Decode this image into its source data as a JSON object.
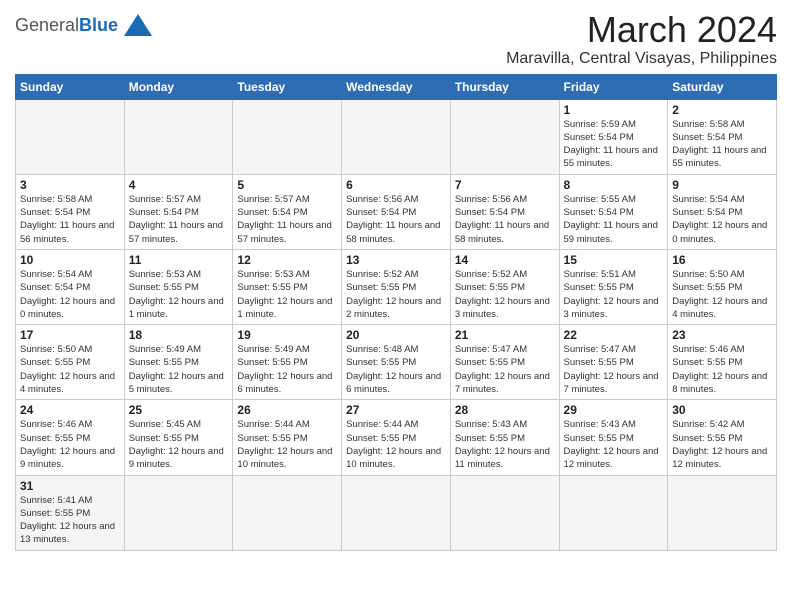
{
  "header": {
    "logo_general": "General",
    "logo_blue": "Blue",
    "month_title": "March 2024",
    "location": "Maravilla, Central Visayas, Philippines"
  },
  "days_of_week": [
    "Sunday",
    "Monday",
    "Tuesday",
    "Wednesday",
    "Thursday",
    "Friday",
    "Saturday"
  ],
  "weeks": [
    [
      {
        "day": "",
        "empty": true
      },
      {
        "day": "",
        "empty": true
      },
      {
        "day": "",
        "empty": true
      },
      {
        "day": "",
        "empty": true
      },
      {
        "day": "",
        "empty": true
      },
      {
        "day": "1",
        "sunrise": "5:59 AM",
        "sunset": "5:54 PM",
        "daylight": "11 hours and 55 minutes."
      },
      {
        "day": "2",
        "sunrise": "5:58 AM",
        "sunset": "5:54 PM",
        "daylight": "11 hours and 55 minutes."
      }
    ],
    [
      {
        "day": "3",
        "sunrise": "5:58 AM",
        "sunset": "5:54 PM",
        "daylight": "11 hours and 56 minutes."
      },
      {
        "day": "4",
        "sunrise": "5:57 AM",
        "sunset": "5:54 PM",
        "daylight": "11 hours and 57 minutes."
      },
      {
        "day": "5",
        "sunrise": "5:57 AM",
        "sunset": "5:54 PM",
        "daylight": "11 hours and 57 minutes."
      },
      {
        "day": "6",
        "sunrise": "5:56 AM",
        "sunset": "5:54 PM",
        "daylight": "11 hours and 58 minutes."
      },
      {
        "day": "7",
        "sunrise": "5:56 AM",
        "sunset": "5:54 PM",
        "daylight": "11 hours and 58 minutes."
      },
      {
        "day": "8",
        "sunrise": "5:55 AM",
        "sunset": "5:54 PM",
        "daylight": "11 hours and 59 minutes."
      },
      {
        "day": "9",
        "sunrise": "5:54 AM",
        "sunset": "5:54 PM",
        "daylight": "12 hours and 0 minutes."
      }
    ],
    [
      {
        "day": "10",
        "sunrise": "5:54 AM",
        "sunset": "5:54 PM",
        "daylight": "12 hours and 0 minutes."
      },
      {
        "day": "11",
        "sunrise": "5:53 AM",
        "sunset": "5:55 PM",
        "daylight": "12 hours and 1 minute."
      },
      {
        "day": "12",
        "sunrise": "5:53 AM",
        "sunset": "5:55 PM",
        "daylight": "12 hours and 1 minute."
      },
      {
        "day": "13",
        "sunrise": "5:52 AM",
        "sunset": "5:55 PM",
        "daylight": "12 hours and 2 minutes."
      },
      {
        "day": "14",
        "sunrise": "5:52 AM",
        "sunset": "5:55 PM",
        "daylight": "12 hours and 3 minutes."
      },
      {
        "day": "15",
        "sunrise": "5:51 AM",
        "sunset": "5:55 PM",
        "daylight": "12 hours and 3 minutes."
      },
      {
        "day": "16",
        "sunrise": "5:50 AM",
        "sunset": "5:55 PM",
        "daylight": "12 hours and 4 minutes."
      }
    ],
    [
      {
        "day": "17",
        "sunrise": "5:50 AM",
        "sunset": "5:55 PM",
        "daylight": "12 hours and 4 minutes."
      },
      {
        "day": "18",
        "sunrise": "5:49 AM",
        "sunset": "5:55 PM",
        "daylight": "12 hours and 5 minutes."
      },
      {
        "day": "19",
        "sunrise": "5:49 AM",
        "sunset": "5:55 PM",
        "daylight": "12 hours and 6 minutes."
      },
      {
        "day": "20",
        "sunrise": "5:48 AM",
        "sunset": "5:55 PM",
        "daylight": "12 hours and 6 minutes."
      },
      {
        "day": "21",
        "sunrise": "5:47 AM",
        "sunset": "5:55 PM",
        "daylight": "12 hours and 7 minutes."
      },
      {
        "day": "22",
        "sunrise": "5:47 AM",
        "sunset": "5:55 PM",
        "daylight": "12 hours and 7 minutes."
      },
      {
        "day": "23",
        "sunrise": "5:46 AM",
        "sunset": "5:55 PM",
        "daylight": "12 hours and 8 minutes."
      }
    ],
    [
      {
        "day": "24",
        "sunrise": "5:46 AM",
        "sunset": "5:55 PM",
        "daylight": "12 hours and 9 minutes."
      },
      {
        "day": "25",
        "sunrise": "5:45 AM",
        "sunset": "5:55 PM",
        "daylight": "12 hours and 9 minutes."
      },
      {
        "day": "26",
        "sunrise": "5:44 AM",
        "sunset": "5:55 PM",
        "daylight": "12 hours and 10 minutes."
      },
      {
        "day": "27",
        "sunrise": "5:44 AM",
        "sunset": "5:55 PM",
        "daylight": "12 hours and 10 minutes."
      },
      {
        "day": "28",
        "sunrise": "5:43 AM",
        "sunset": "5:55 PM",
        "daylight": "12 hours and 11 minutes."
      },
      {
        "day": "29",
        "sunrise": "5:43 AM",
        "sunset": "5:55 PM",
        "daylight": "12 hours and 12 minutes."
      },
      {
        "day": "30",
        "sunrise": "5:42 AM",
        "sunset": "5:55 PM",
        "daylight": "12 hours and 12 minutes."
      }
    ],
    [
      {
        "day": "31",
        "sunrise": "5:41 AM",
        "sunset": "5:55 PM",
        "daylight": "12 hours and 13 minutes."
      },
      {
        "day": "",
        "empty": true
      },
      {
        "day": "",
        "empty": true
      },
      {
        "day": "",
        "empty": true
      },
      {
        "day": "",
        "empty": true
      },
      {
        "day": "",
        "empty": true
      },
      {
        "day": "",
        "empty": true
      }
    ]
  ]
}
